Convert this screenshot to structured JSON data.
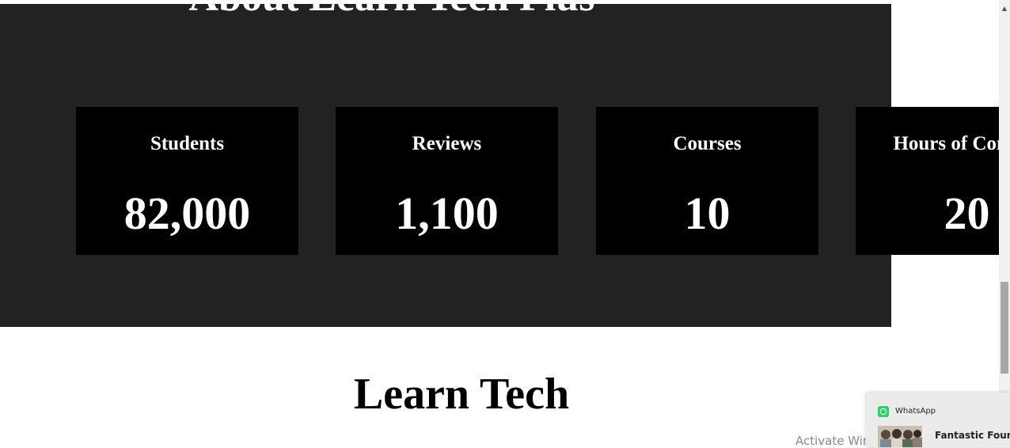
{
  "about": {
    "title": "About Learn Tech Plus",
    "stats": [
      {
        "label": "Students",
        "value": "82,000"
      },
      {
        "label": "Reviews",
        "value": "1,100"
      },
      {
        "label": "Courses",
        "value": "10"
      },
      {
        "label": "Hours of Content",
        "value": "20"
      }
    ]
  },
  "learn_section": {
    "heading": "Learn Tech"
  },
  "os_watermark": "Activate Windows",
  "notification": {
    "app_name": "WhatsApp",
    "sender": "Fantastic Fours",
    "icon": "whatsapp-icon"
  },
  "colors": {
    "section_bg": "#222222",
    "card_bg": "#000000",
    "text_light": "#ffffff",
    "whatsapp_green": "#25d366"
  }
}
